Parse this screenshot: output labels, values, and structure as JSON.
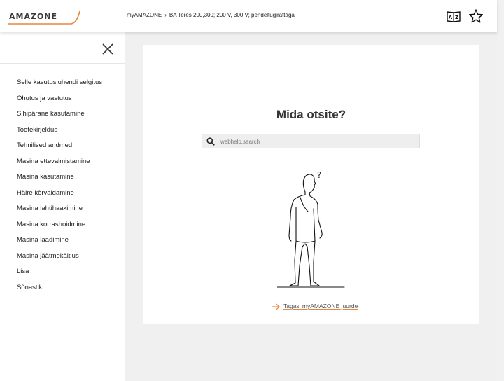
{
  "header": {
    "logo_text": "AMAZONE",
    "breadcrumb": [
      "myAMAZONE",
      "BA Teres 200,300; 200 V, 300 V; pendeltugirattaga"
    ],
    "breadcrumb_separator": "›",
    "icons": [
      "dictionary-icon",
      "star-icon"
    ]
  },
  "sidebar": {
    "close_icon": "close-icon",
    "items": [
      {
        "label": "Selle kasutusjuhendi selgitus"
      },
      {
        "label": "Ohutus ja vastutus"
      },
      {
        "label": "Sihipärane kasutamine"
      },
      {
        "label": "Tootekirjeldus"
      },
      {
        "label": "Tehnilised andmed"
      },
      {
        "label": "Masina ettevalmistamine"
      },
      {
        "label": "Masina kasutamine"
      },
      {
        "label": "Häire kõrvaldamine"
      },
      {
        "label": "Masina lahtihaakimine"
      },
      {
        "label": "Masina korrashoidmine"
      },
      {
        "label": "Masina laadimine"
      },
      {
        "label": "Masina jäätmekäitlus"
      },
      {
        "label": "Lisa"
      },
      {
        "label": "Sõnastik"
      }
    ]
  },
  "main": {
    "heading": "Mida otsite?",
    "search": {
      "placeholder": "webhelp.search",
      "value": ""
    },
    "illustration_text": "?",
    "back_link": "Tagasi myAMAZONE juurde"
  },
  "colors": {
    "accent": "#e8853d",
    "background": "#f0f0f0"
  }
}
